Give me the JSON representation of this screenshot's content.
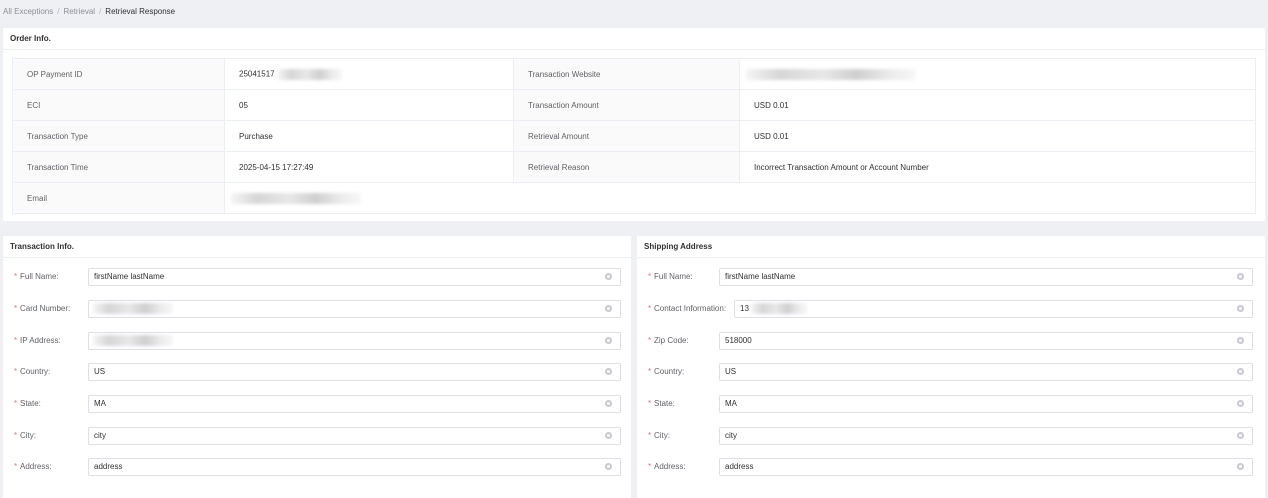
{
  "breadcrumb": {
    "items": [
      "All Exceptions",
      "Retrieval"
    ],
    "separator": "/",
    "current": "Retrieval Response"
  },
  "order": {
    "title": "Order Info.",
    "op_payment_id_label": "OP Payment ID",
    "op_payment_id_value": "25041517",
    "website_label": "Transaction Website",
    "eci_label": "ECI",
    "eci_value": "05",
    "amount_label": "Transaction Amount",
    "amount_value": "USD 0.01",
    "type_label": "Transaction Type",
    "type_value": "Purchase",
    "retrieval_amount_label": "Retrieval Amount",
    "retrieval_amount_value": "USD 0.01",
    "time_label": "Transaction Time",
    "time_value": "2025-04-15 17:27:49",
    "reason_label": "Retrieval Reason",
    "reason_value": "Incorrect Transaction Amount or Account Number",
    "email_label": "Email"
  },
  "transaction": {
    "title": "Transaction Info.",
    "required_mark": "*",
    "fields": [
      {
        "label": "Full Name:",
        "value": "firstName lastName"
      },
      {
        "label": "Card Number:",
        "value": ""
      },
      {
        "label": "IP Address:",
        "value": ""
      },
      {
        "label": "Country:",
        "value": "US"
      },
      {
        "label": "State:",
        "value": "MA"
      },
      {
        "label": "City:",
        "value": "city"
      },
      {
        "label": "Address:",
        "value": "address"
      }
    ]
  },
  "shipping": {
    "title": "Shipping Address",
    "required_mark": "*",
    "fields": [
      {
        "label": "Full Name:",
        "value": "firstName lastName"
      },
      {
        "label": "Contact Information:",
        "value": "13"
      },
      {
        "label": "Zip Code:",
        "value": "518000"
      },
      {
        "label": "Country:",
        "value": "US"
      },
      {
        "label": "State:",
        "value": "MA"
      },
      {
        "label": "City:",
        "value": "city"
      },
      {
        "label": "Address:",
        "value": "address"
      }
    ]
  }
}
